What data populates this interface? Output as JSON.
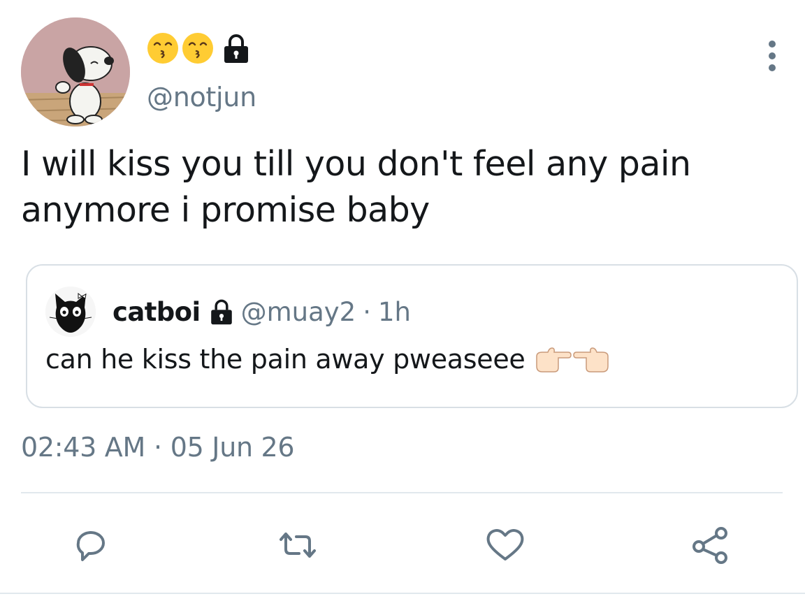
{
  "author": {
    "display_emoji": [
      "kissing-face-with-smiling-eyes",
      "kissing-face-with-smiling-eyes"
    ],
    "locked": true,
    "handle": "@notjun"
  },
  "tweet": {
    "text_line1": "I will kiss you till you don't feel any pain",
    "text_line2": "anymore i promise baby"
  },
  "quoted": {
    "name": "catboi",
    "locked": true,
    "handle": "@muay2",
    "separator": "·",
    "time": "1h",
    "text": "can he kiss the pain away pweaseee",
    "trailing_emoji": [
      "backhand-index-pointing-right",
      "backhand-index-pointing-left"
    ]
  },
  "meta": {
    "time": "02:43 AM",
    "separator": "·",
    "date": "05 Jun 26"
  },
  "actions": [
    "reply-icon",
    "retweet-icon",
    "like-icon",
    "share-icon"
  ],
  "colors": {
    "secondary_text": "#657786",
    "primary_text": "#14171a",
    "icon": "#657786",
    "border": "#d8dfe5"
  }
}
